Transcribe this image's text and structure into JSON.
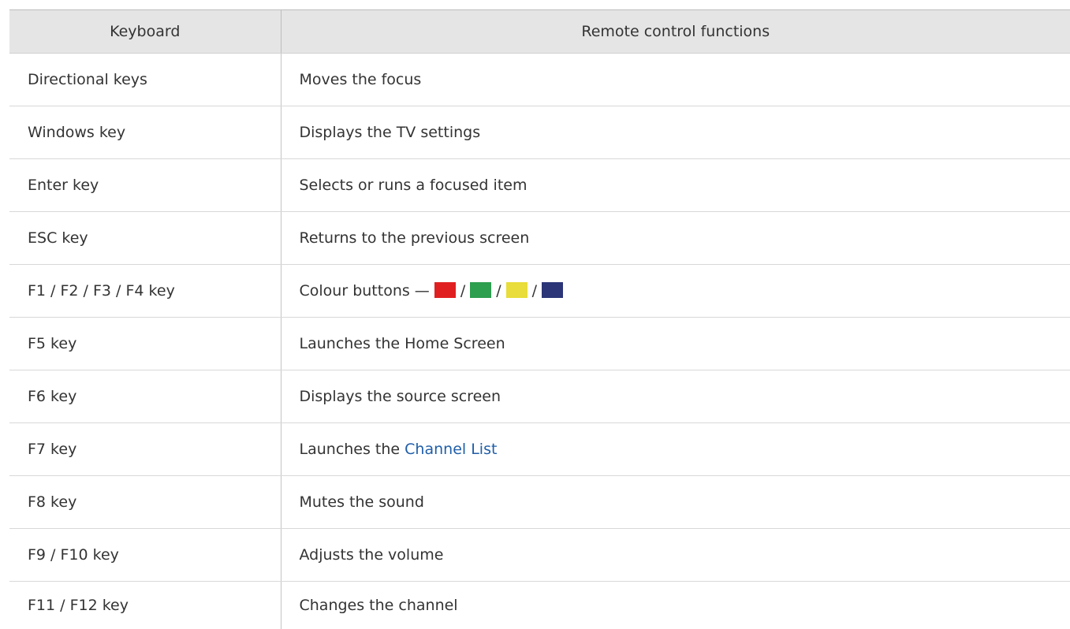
{
  "table": {
    "headers": [
      "Keyboard",
      "Remote control functions"
    ],
    "rows": [
      {
        "key": "Directional keys",
        "function": "Moves the focus"
      },
      {
        "key": "Windows key",
        "function": "Displays the TV settings"
      },
      {
        "key": "Enter key",
        "function": "Selects or runs a focused item"
      },
      {
        "key": "ESC key",
        "function": "Returns to the previous screen"
      },
      {
        "key": "F1 / F2 / F3 / F4 key",
        "function": "Colour buttons —",
        "separator": "/"
      },
      {
        "key": "F5 key",
        "function": "Launches the Home Screen"
      },
      {
        "key": "F6 key",
        "function": "Displays the source screen"
      },
      {
        "key": "F7 key",
        "function": "Launches the ",
        "function_link": "Channel List"
      },
      {
        "key": "F8 key",
        "function": "Mutes the sound"
      },
      {
        "key": "F9 / F10 key",
        "function": "Adjusts the volume"
      },
      {
        "key": "F11 / F12 key",
        "function": "Changes the channel"
      }
    ]
  },
  "colors": {
    "red_button": "#e02020",
    "green_button": "#2e9e4f",
    "yellow_button": "#e8dd3a",
    "blue_button": "#2b3577",
    "link": "#1f5ea8",
    "header_bg": "#e5e5e5"
  }
}
